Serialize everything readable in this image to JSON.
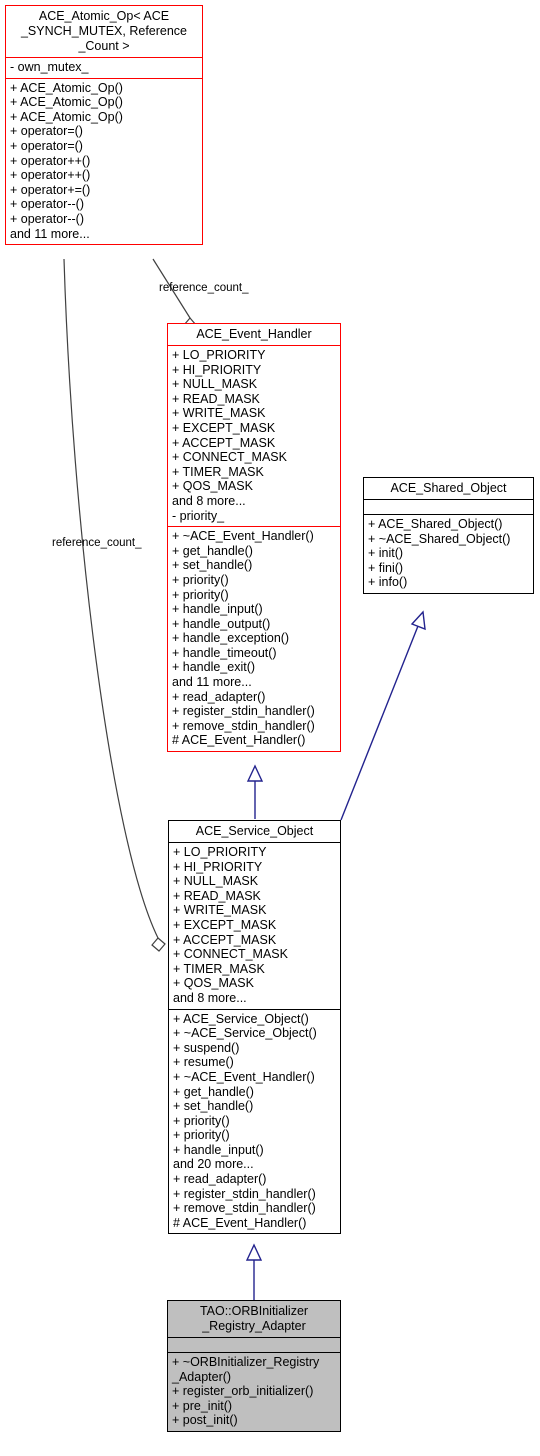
{
  "diagram": {
    "type": "uml-class-diagram",
    "background": "#ffffff",
    "colors": {
      "highlight_border": "#ff0000",
      "normal_border": "#000000",
      "inheritance_edge": "#23238e",
      "aggregation_edge": "#404040",
      "focus_fill": "#bfbfbf"
    }
  },
  "classes": {
    "atomic_op": {
      "title_lines": [
        "ACE_Atomic_Op< ACE",
        "_SYNCH_MUTEX, Reference",
        "_Count >"
      ],
      "attributes": [
        "- own_mutex_"
      ],
      "operations": [
        "+ ACE_Atomic_Op()",
        "+ ACE_Atomic_Op()",
        "+ ACE_Atomic_Op()",
        "+ operator=()",
        "+ operator=()",
        "+ operator++()",
        "+ operator++()",
        "+ operator+=()",
        "+ operator--()",
        "+ operator--()",
        "and 11 more..."
      ]
    },
    "event_handler": {
      "title_lines": [
        "ACE_Event_Handler"
      ],
      "attributes": [
        "+ LO_PRIORITY",
        "+ HI_PRIORITY",
        "+ NULL_MASK",
        "+ READ_MASK",
        "+ WRITE_MASK",
        "+ EXCEPT_MASK",
        "+ ACCEPT_MASK",
        "+ CONNECT_MASK",
        "+ TIMER_MASK",
        "+ QOS_MASK",
        "and 8 more...",
        "- priority_"
      ],
      "operations": [
        "+ ~ACE_Event_Handler()",
        "+ get_handle()",
        "+ set_handle()",
        "+ priority()",
        "+ priority()",
        "+ handle_input()",
        "+ handle_output()",
        "+ handle_exception()",
        "+ handle_timeout()",
        "+ handle_exit()",
        "and 11 more...",
        "+ read_adapter()",
        "+ register_stdin_handler()",
        "+ remove_stdin_handler()",
        "# ACE_Event_Handler()"
      ]
    },
    "shared_object": {
      "title_lines": [
        "ACE_Shared_Object"
      ],
      "attributes": [],
      "operations": [
        "+ ACE_Shared_Object()",
        "+ ~ACE_Shared_Object()",
        "+ init()",
        "+ fini()",
        "+ info()"
      ]
    },
    "service_object": {
      "title_lines": [
        "ACE_Service_Object"
      ],
      "attributes": [
        "+ LO_PRIORITY",
        "+ HI_PRIORITY",
        "+ NULL_MASK",
        "+ READ_MASK",
        "+ WRITE_MASK",
        "+ EXCEPT_MASK",
        "+ ACCEPT_MASK",
        "+ CONNECT_MASK",
        "+ TIMER_MASK",
        "+ QOS_MASK",
        "and 8 more..."
      ],
      "operations": [
        "+ ACE_Service_Object()",
        "+ ~ACE_Service_Object()",
        "+ suspend()",
        "+ resume()",
        "+ ~ACE_Event_Handler()",
        "+ get_handle()",
        "+ set_handle()",
        "+ priority()",
        "+ priority()",
        "+ handle_input()",
        "and 20 more...",
        "+ read_adapter()",
        "+ register_stdin_handler()",
        "+ remove_stdin_handler()",
        "# ACE_Event_Handler()"
      ]
    },
    "orbinitializer_registry_adapter": {
      "title_lines": [
        "TAO::ORBInitializer",
        "_Registry_Adapter"
      ],
      "attributes": [],
      "operations": [
        "+ ~ORBInitializer_Registry\n_Adapter()",
        "+ register_orb_initializer()",
        "+ pre_init()",
        "+ post_init()"
      ]
    }
  },
  "edges": {
    "aggregation_to_event_handler_label": "reference_count_",
    "aggregation_to_service_object_label": "reference_count_"
  }
}
